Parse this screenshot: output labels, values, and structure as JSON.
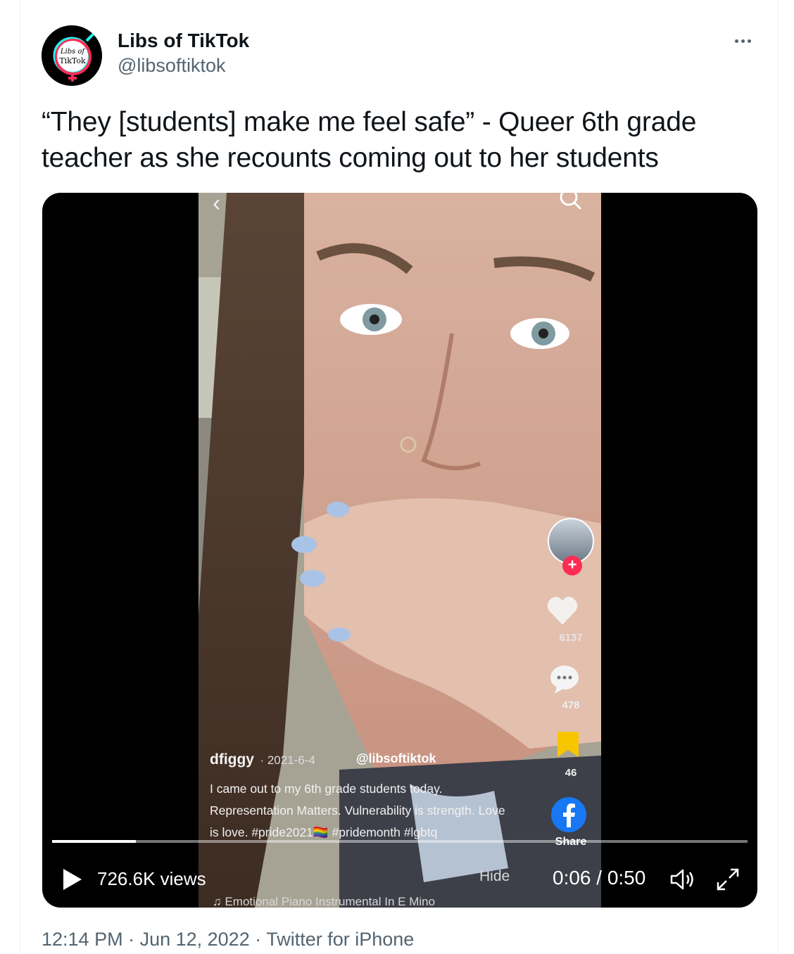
{
  "author": {
    "name": "Libs of TikTok",
    "handle": "@libsoftiktok",
    "avatar_text": "Libs of TikTok"
  },
  "tweet": {
    "text": "“They [students] make me feel safe” - Queer 6th grade teacher as she recounts coming out to her students"
  },
  "tiktok": {
    "username": "dfiggy",
    "date": "· 2021-6-4",
    "watermark": "@libsoftiktok",
    "description": "I came out to my 6th grade students today. Representation Matters. Vulnerability is strength. Love is love. #pride2021🏳️‍🌈 #pridemonth #lgbtq",
    "music": "♫ Emotional Piano Instrumental In E Mino",
    "likes": "6137",
    "comments": "478",
    "bookmarks": "46",
    "share_label": "Share",
    "follow_glyph": "+"
  },
  "player": {
    "views": "726.6K views",
    "hide_label": "Hide",
    "time": "0:06 / 0:50",
    "progress_fraction": 0.12
  },
  "meta": {
    "time": "12:14 PM",
    "date": "Jun 12, 2022",
    "source": "Twitter for iPhone",
    "separator": " · "
  },
  "colors": {
    "tiktok_pink": "#fe2c55",
    "tiktok_cyan": "#25f4ee",
    "twitter_gray": "#536471"
  },
  "icons": [
    "more-icon",
    "back-chevron-icon",
    "search-icon",
    "heart-icon",
    "comment-icon",
    "bookmark-icon",
    "facebook-icon",
    "play-icon",
    "volume-icon",
    "fullscreen-icon"
  ]
}
